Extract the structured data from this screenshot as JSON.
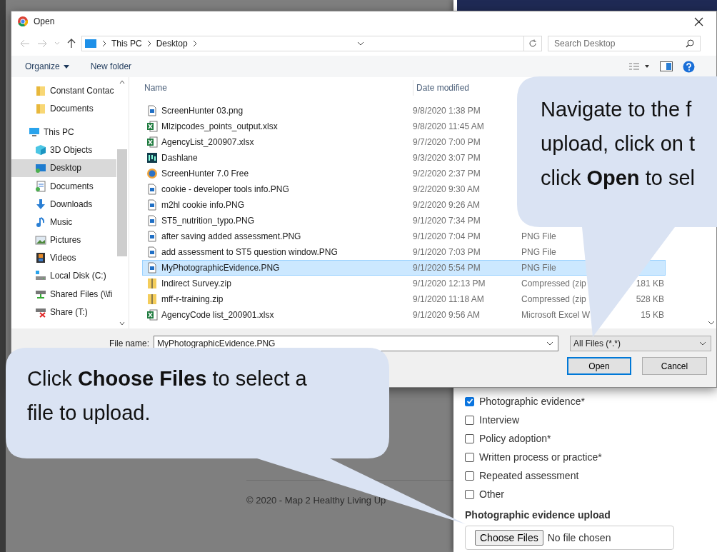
{
  "background_page": {
    "footer": "© 2020 - Map 2 Healthy Living Up",
    "evidence_options": [
      {
        "label": "Photographic evidence*",
        "checked": true
      },
      {
        "label": "Interview",
        "checked": false
      },
      {
        "label": "Policy adoption*",
        "checked": false
      },
      {
        "label": "Written process or practice*",
        "checked": false
      },
      {
        "label": "Repeated assessment",
        "checked": false
      },
      {
        "label": "Other",
        "checked": false
      }
    ],
    "upload": {
      "label": "Photographic evidence upload",
      "button": "Choose Files",
      "status": "No file chosen"
    }
  },
  "dialog": {
    "title": "Open",
    "breadcrumb": [
      "This PC",
      "Desktop"
    ],
    "search": {
      "placeholder": "Search Desktop"
    },
    "toolbar": {
      "organize": "Organize",
      "new_folder": "New folder"
    },
    "navigation": {
      "quick_access": [
        {
          "label": "Constant Contac",
          "kind": "folder",
          "selected": false
        },
        {
          "label": "Documents",
          "kind": "folder",
          "selected": false
        }
      ],
      "this_pc": {
        "label": "This PC",
        "kind": "pc",
        "children": [
          {
            "label": "3D Objects",
            "kind": "cube",
            "selected": false
          },
          {
            "label": "Desktop",
            "kind": "desktop",
            "selected": true
          },
          {
            "label": "Documents",
            "kind": "documents",
            "selected": false
          },
          {
            "label": "Downloads",
            "kind": "download",
            "selected": false
          },
          {
            "label": "Music",
            "kind": "music",
            "selected": false
          },
          {
            "label": "Pictures",
            "kind": "pictures",
            "selected": false
          },
          {
            "label": "Videos",
            "kind": "videos",
            "selected": false
          },
          {
            "label": "Local Disk (C:)",
            "kind": "disk",
            "selected": false
          },
          {
            "label": "Shared Files (\\\\fi",
            "kind": "network",
            "selected": false
          },
          {
            "label": "Share (T:)",
            "kind": "network_off",
            "selected": false
          }
        ]
      }
    },
    "columns": [
      "Name",
      "Date modified"
    ],
    "files": [
      {
        "name": "ScreenHunter 03.png",
        "date": "9/8/2020 1:38 PM",
        "kind": "image",
        "selected": false
      },
      {
        "name": "Mlzipcodes_points_output.xlsx",
        "date": "9/8/2020 11:45 AM",
        "kind": "excel",
        "selected": false
      },
      {
        "name": "AgencyList_200907.xlsx",
        "date": "9/7/2020 7:00 PM",
        "kind": "excel",
        "selected": false
      },
      {
        "name": "Dashlane",
        "date": "9/3/2020 3:07 PM",
        "kind": "app",
        "selected": false
      },
      {
        "name": "ScreenHunter 7.0 Free",
        "date": "9/2/2020 2:37 PM",
        "kind": "shortcut",
        "selected": false
      },
      {
        "name": "cookie - developer tools info.PNG",
        "date": "9/2/2020 9:30 AM",
        "kind": "image",
        "selected": false
      },
      {
        "name": "m2hl cookie info.PNG",
        "date": "9/2/2020 9:26 AM",
        "kind": "image",
        "selected": false
      },
      {
        "name": "ST5_nutrition_typo.PNG",
        "date": "9/1/2020 7:34 PM",
        "kind": "image",
        "selected": false
      },
      {
        "name": "after saving added assessment.PNG",
        "date": "9/1/2020 7:04 PM",
        "kind": "image",
        "selected": false,
        "type": "PNG File"
      },
      {
        "name": "add assessment to ST5 question window.PNG",
        "date": "9/1/2020 7:03 PM",
        "kind": "image",
        "selected": false,
        "type": "PNG File"
      },
      {
        "name": "MyPhotographicEvidence.PNG",
        "date": "9/1/2020 5:54 PM",
        "kind": "image",
        "selected": true,
        "type": "PNG File"
      },
      {
        "name": "Indirect Survey.zip",
        "date": "9/1/2020 12:13 PM",
        "kind": "zip",
        "selected": false,
        "type": "Compressed (zip",
        "size": "181 KB"
      },
      {
        "name": "mff-r-training.zip",
        "date": "9/1/2020 11:18 AM",
        "kind": "zip",
        "selected": false,
        "type": "Compressed (zip",
        "size": "528 KB"
      },
      {
        "name": "AgencyCode list_200901.xlsx",
        "date": "9/1/2020 9:56 AM",
        "kind": "excel",
        "selected": false,
        "type": "Microsoft Excel W",
        "size": "15 KB"
      }
    ],
    "file_name": {
      "label": "File name:",
      "value": "MyPhotographicEvidence.PNG"
    },
    "filter": "All Files (*.*)",
    "buttons": [
      {
        "label": "Open",
        "kind": "primary"
      },
      {
        "label": "Cancel",
        "kind": "secondary"
      }
    ]
  },
  "callouts": [
    {
      "lines": [
        "Navigate to the f",
        "upload, click on t",
        "click **Open** to sel"
      ]
    },
    {
      "lines": [
        "Click **Choose Files** to select a",
        "file to upload."
      ]
    }
  ]
}
